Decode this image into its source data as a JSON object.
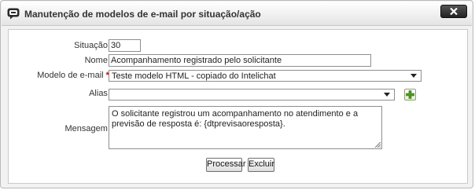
{
  "dialog": {
    "title": "Manutenção de modelos de e-mail por situação/ação",
    "icon": "chat-bubble-icon",
    "close_icon": "close-x-icon"
  },
  "form": {
    "situacao": {
      "label": "Situação",
      "value": "30"
    },
    "nome": {
      "label": "Nome",
      "value": "Acompanhamento registrado pelo solicitante"
    },
    "modelo": {
      "label": "Modelo de e-mail",
      "required_mark": "*",
      "value": "Teste modelo HTML - copiado do Intelichat"
    },
    "alias": {
      "label": "Alias",
      "value": "",
      "add_icon": "plus-icon"
    },
    "mensagem": {
      "label": "Mensagem",
      "value": "O solicitante registrou um acompanhamento no atendimento e a previsão de resposta é: {dtprevisaoresposta}."
    },
    "colon": ":"
  },
  "buttons": {
    "processar": "Processar",
    "excluir": "Excluir"
  }
}
